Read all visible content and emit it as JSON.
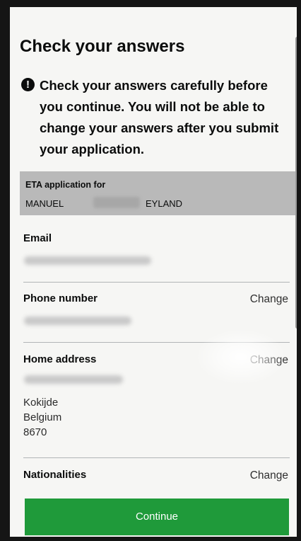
{
  "page": {
    "title": "Check your answers"
  },
  "warning": {
    "icon": "exclamation-circle-icon",
    "icon_glyph": "!",
    "text": "Check your answers carefully before you continue. You will not be able to change your answers after you submit your application."
  },
  "applicant_summary": {
    "caption": "ETA application for",
    "first_name": "MANUEL",
    "last_name": "EYLAND"
  },
  "rows": {
    "email": {
      "label": "Email"
    },
    "phone": {
      "label": "Phone number",
      "change_label": "Change"
    },
    "home_address": {
      "label": "Home address",
      "change_label": "Change",
      "city": "Kokijde",
      "country": "Belgium",
      "postcode": "8670"
    },
    "nationalities": {
      "label": "Nationalities",
      "change_label": "Change"
    }
  },
  "actions": {
    "continue_label": "Continue"
  },
  "colors": {
    "primary_button": "#1f9a3a",
    "summary_background": "#b9b9b9",
    "text": "#0b0c0c"
  }
}
